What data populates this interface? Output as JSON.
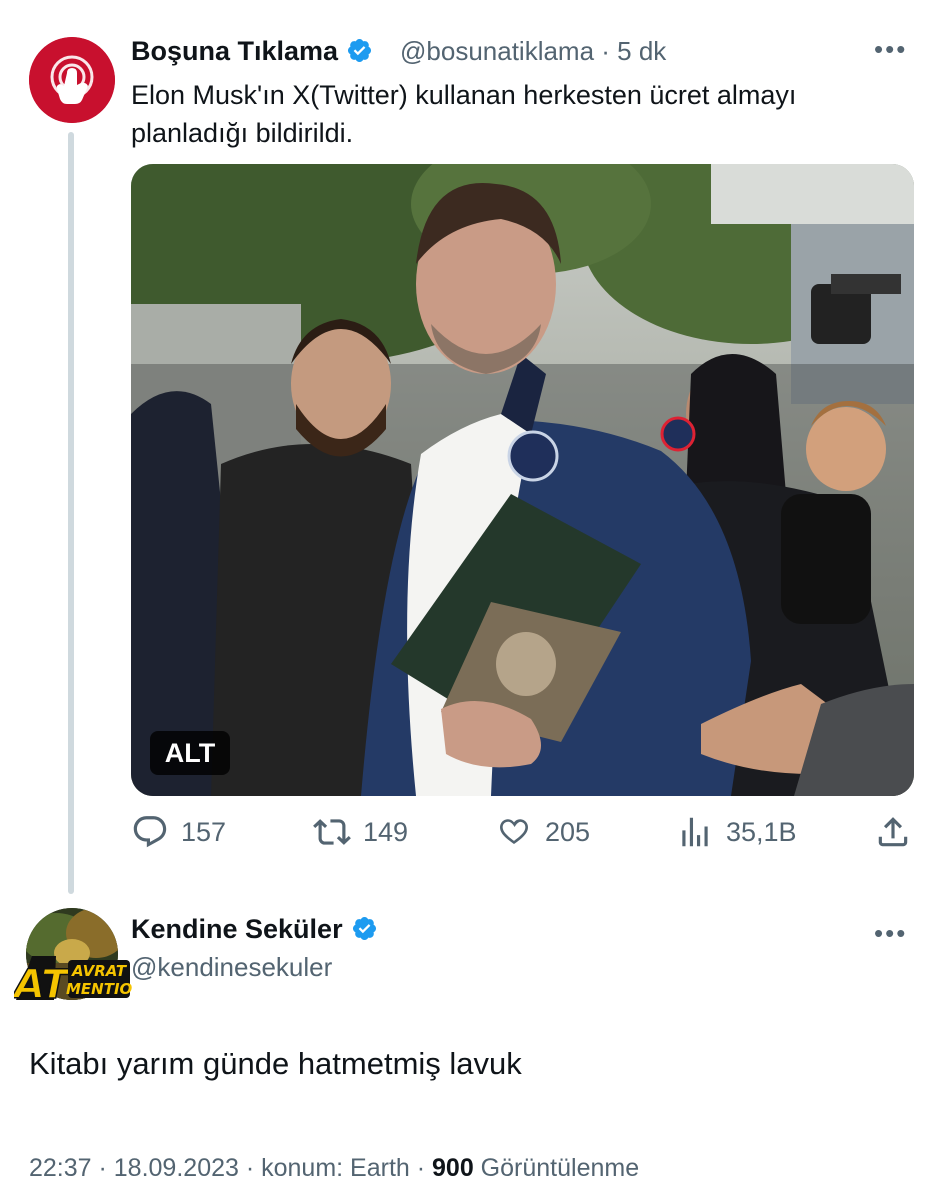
{
  "tweet1": {
    "author_name": "Boşuna Tıklama",
    "handle_time": "@bosunatiklama · 5 dk",
    "text": "Elon Musk'ın X(Twitter) kullanan herkesten ücret almayı planladığı bildirildi.",
    "media_alt_badge": "ALT",
    "more_icon": "more-horizontal-icon",
    "actions": {
      "replies": "157",
      "retweets": "149",
      "likes": "205",
      "views": "35,1B"
    }
  },
  "tweet2": {
    "author_name": "Kendine Seküler",
    "handle": "@kendinesekuler",
    "avatar_logo": "AT AVRAT MENTION",
    "text": "Kitabı yarım günde hatmetmiş lavuk",
    "meta_prefix": "22:37 · 18.09.2023 · konum: Earth · ",
    "meta_views_count": "900",
    "meta_views_label": " Görüntülenme"
  },
  "colors": {
    "verified": "#1d9bf0",
    "secondary_text": "#536471",
    "thread_line": "#cfd9de",
    "avatar1_bg": "#c8102e"
  }
}
